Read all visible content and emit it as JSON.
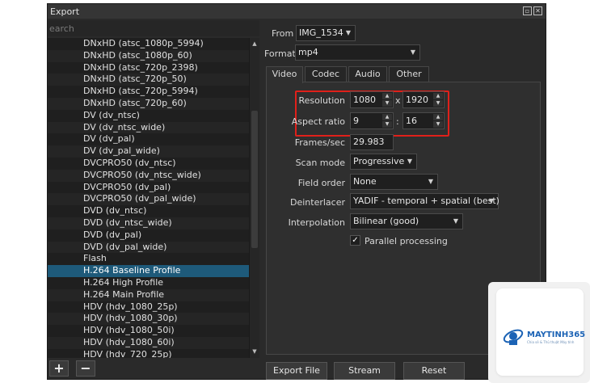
{
  "window": {
    "title": "Export"
  },
  "search": {
    "placeholder": "earch"
  },
  "formats_list": {
    "items": [
      "DNxHD (atsc_1080p_5994)",
      "DNxHD (atsc_1080p_60)",
      "DNxHD (atsc_720p_2398)",
      "DNxHD (atsc_720p_50)",
      "DNxHD (atsc_720p_5994)",
      "DNxHD (atsc_720p_60)",
      "DV (dv_ntsc)",
      "DV (dv_ntsc_wide)",
      "DV (dv_pal)",
      "DV (dv_pal_wide)",
      "DVCPRO50 (dv_ntsc)",
      "DVCPRO50 (dv_ntsc_wide)",
      "DVCPRO50 (dv_pal)",
      "DVCPRO50 (dv_pal_wide)",
      "DVD (dv_ntsc)",
      "DVD (dv_ntsc_wide)",
      "DVD (dv_pal)",
      "DVD (dv_pal_wide)",
      "Flash",
      "H.264 Baseline Profile",
      "H.264 High Profile",
      "H.264 Main Profile",
      "HDV (hdv_1080_25p)",
      "HDV (hdv_1080_30p)",
      "HDV (hdv_1080_50i)",
      "HDV (hdv_1080_60i)",
      "HDV (hdv_720_25p)"
    ],
    "selected": "H.264 Baseline Profile"
  },
  "list_buttons": {
    "add": "+",
    "remove": "−"
  },
  "from": {
    "label": "From",
    "value": "IMG_1534"
  },
  "format": {
    "label": "Format",
    "value": "mp4"
  },
  "tabs": [
    "Video",
    "Codec",
    "Audio",
    "Other"
  ],
  "active_tab": "Video",
  "video": {
    "resolution_label": "Resolution",
    "resolution_width": "1080",
    "resolution_sep": "x",
    "resolution_height": "1920",
    "aspect_label": "Aspect ratio",
    "aspect_num": "9",
    "aspect_sep": ":",
    "aspect_den": "16",
    "fps_label": "Frames/sec",
    "fps_value": "29.983",
    "scan_label": "Scan mode",
    "scan_value": "Progressive",
    "field_label": "Field order",
    "field_value": "None",
    "deint_label": "Deinterlacer",
    "deint_value": "YADIF - temporal + spatial (best)",
    "interp_label": "Interpolation",
    "interp_value": "Bilinear (good)",
    "parallel_label": "Parallel processing",
    "parallel_checked": true
  },
  "actions": {
    "export_file": "Export File",
    "stream": "Stream",
    "reset": "Reset"
  },
  "watermark": {
    "brand": "MAYTINH365",
    "tagline": "Chia sẻ & Thủ thuật Máy tính"
  },
  "colors": {
    "highlight": "#e0201a",
    "selection": "#1e5a7a",
    "brand": "#1c63b5"
  }
}
